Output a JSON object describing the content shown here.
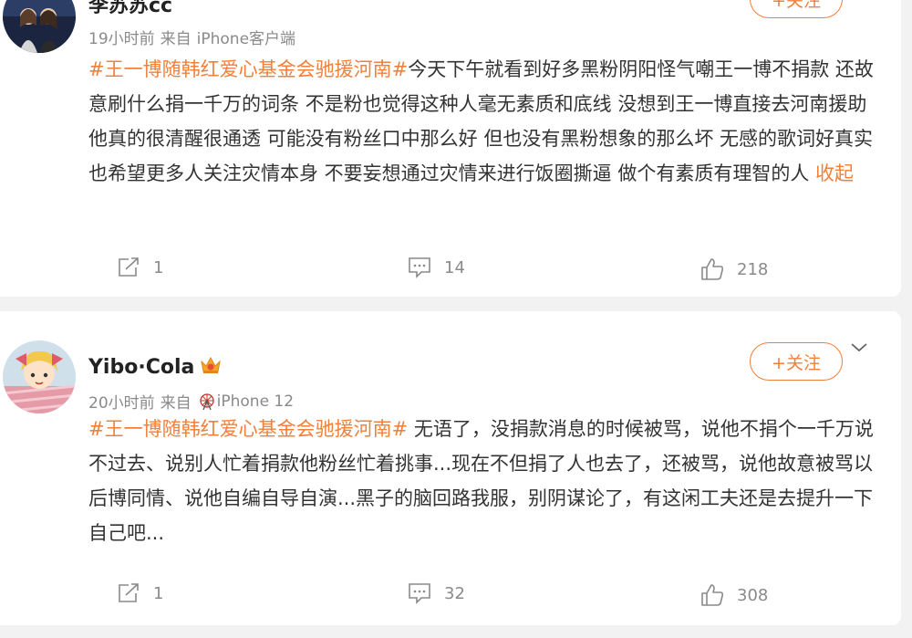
{
  "posts": [
    {
      "username": "李苏苏cc",
      "time": "19小时前",
      "source_prefix": "来自",
      "source": "iPhone客户端",
      "follow_label": "+关注",
      "hashtag": "#王一博随韩红爱心基金会驰援河南#",
      "body": "今天下午就看到好多黑粉阴阳怪气嘲王一博不捐款 还故意刷什么捐一千万的词条 不是粉也觉得这种人毫无素质和底线 没想到王一博直接去河南援助 他真的很清醒很通透 可能没有粉丝口中那么好 但也没有黑粉想象的那么坏 无感的歌词好真实 也希望更多人关注灾情本身 不要妄想通过灾情来进行饭圈撕逼 做个有素质有理智的人",
      "collapse_label": "收起",
      "reposts": "1",
      "comments": "14",
      "likes": "218"
    },
    {
      "username": "Yibo·Cola",
      "time": "20小时前",
      "source_prefix": "来自",
      "source": "iPhone 12",
      "follow_label": "+关注",
      "hashtag": "#王一博随韩红爱心基金会驰援河南#",
      "body": " 无语了，没捐款消息的时候被骂，说他不捐个一千万说不过去、说别人忙着捐款他粉丝忙着挑事...现在不但捐了人也去了，还被骂，说他故意被骂以后博同情、说他自编自导自演...黑子的脑回路我服，别阴谋论了，有这闲工夫还是去提升一下自己吧...",
      "reposts": "1",
      "comments": "32",
      "likes": "308"
    }
  ],
  "icons": {
    "repost": "repost-icon",
    "comment": "comment-icon",
    "like": "thumbs-up-icon",
    "vip": "crown-badge-icon",
    "ferris": "ferris-wheel-icon"
  },
  "colors": {
    "accent": "#f0803a",
    "meta": "#8a8a8a",
    "text": "#333333"
  }
}
